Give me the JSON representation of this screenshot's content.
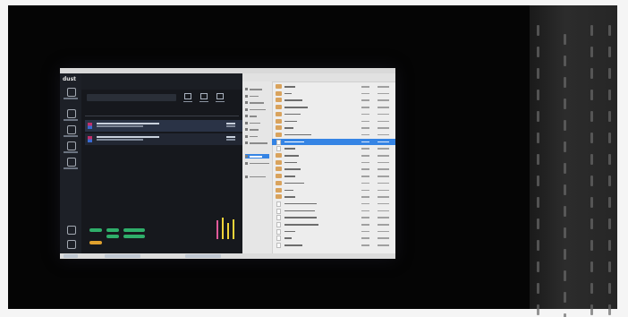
{
  "scene": {
    "description_colors": {
      "background": "#050505",
      "frame": "#f5f5f5",
      "panel": "#262626"
    }
  },
  "monitor": {
    "left_app": {
      "logo": "dust",
      "header_tabs": [
        "",
        ""
      ],
      "columns": [
        "",
        "",
        ""
      ],
      "jobs": [
        {
          "selected": true
        },
        {
          "selected": false
        }
      ],
      "accent_colors": {
        "green": "#2fae6a",
        "orange": "#e0a12e",
        "bar_yellow": "#f0d43a",
        "bar_pink": "#e05a9a"
      }
    },
    "file_manager": {
      "folder_count": 11,
      "selected_row": 2,
      "accent": "#3584e4"
    }
  }
}
